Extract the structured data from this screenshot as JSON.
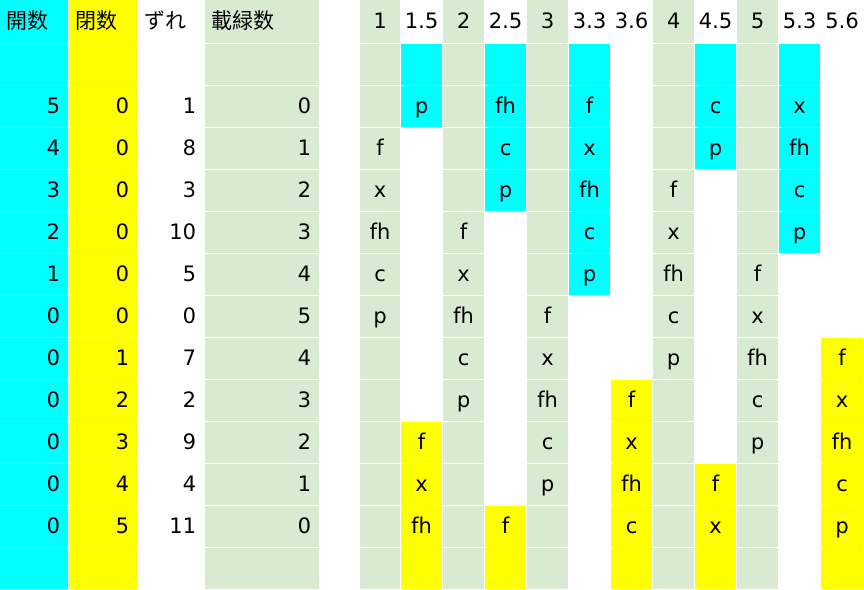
{
  "colors": {
    "cyan": "#00ffff",
    "yellow": "#ffff00",
    "green": "#d9ead3",
    "white": "#ffffff"
  },
  "column_fills": [
    "cyan",
    "yellow",
    "white",
    "green",
    "white",
    "green",
    "white",
    "green",
    "white",
    "green",
    "white",
    "white",
    "green",
    "white",
    "green",
    "white",
    "white"
  ],
  "headers": [
    "開数",
    "閉数",
    "ずれ",
    "載緑数",
    "",
    "1",
    "1.5",
    "2",
    "2.5",
    "3",
    "3.3",
    "3.6",
    "4",
    "4.5",
    "5",
    "5.3",
    "5.6"
  ],
  "rows": [
    {
      "values": [
        "",
        "",
        "",
        "",
        "",
        "",
        "",
        "",
        "",
        "",
        "",
        "",
        "",
        "",
        "",
        "",
        ""
      ],
      "fills": {
        "6": "cyan",
        "8": "cyan",
        "10": "cyan",
        "13": "cyan",
        "15": "cyan"
      }
    },
    {
      "values": [
        "5",
        "0",
        "1",
        "0",
        "",
        "",
        "p",
        "",
        "fh",
        "",
        "f",
        "",
        "",
        "c",
        "",
        "x",
        ""
      ],
      "fills": {
        "6": "cyan",
        "8": "cyan",
        "10": "cyan",
        "13": "cyan",
        "15": "cyan"
      }
    },
    {
      "values": [
        "4",
        "0",
        "8",
        "1",
        "",
        "f",
        "",
        "",
        "c",
        "",
        "x",
        "",
        "",
        "p",
        "",
        "fh",
        ""
      ],
      "fills": {
        "8": "cyan",
        "10": "cyan",
        "13": "cyan",
        "15": "cyan"
      }
    },
    {
      "values": [
        "3",
        "0",
        "3",
        "2",
        "",
        "x",
        "",
        "",
        "p",
        "",
        "fh",
        "",
        "f",
        "",
        "",
        "c",
        ""
      ],
      "fills": {
        "8": "cyan",
        "10": "cyan",
        "15": "cyan"
      }
    },
    {
      "values": [
        "2",
        "0",
        "10",
        "3",
        "",
        "fh",
        "",
        "f",
        "",
        "",
        "c",
        "",
        "x",
        "",
        "",
        "p",
        ""
      ],
      "fills": {
        "10": "cyan",
        "15": "cyan"
      }
    },
    {
      "values": [
        "1",
        "0",
        "5",
        "4",
        "",
        "c",
        "",
        "x",
        "",
        "",
        "p",
        "",
        "fh",
        "",
        "f",
        "",
        ""
      ],
      "fills": {
        "10": "cyan"
      }
    },
    {
      "values": [
        "0",
        "0",
        "0",
        "5",
        "",
        "p",
        "",
        "fh",
        "",
        "f",
        "",
        "",
        "c",
        "",
        "x",
        "",
        ""
      ],
      "fills": {}
    },
    {
      "values": [
        "0",
        "1",
        "7",
        "4",
        "",
        "",
        "",
        "c",
        "",
        "x",
        "",
        "",
        "p",
        "",
        "fh",
        "",
        "f"
      ],
      "fills": {
        "16": "yellow"
      }
    },
    {
      "values": [
        "0",
        "2",
        "2",
        "3",
        "",
        "",
        "",
        "p",
        "",
        "fh",
        "",
        "f",
        "",
        "",
        "c",
        "",
        "x"
      ],
      "fills": {
        "11": "yellow",
        "16": "yellow"
      }
    },
    {
      "values": [
        "0",
        "3",
        "9",
        "2",
        "",
        "",
        "f",
        "",
        "",
        "c",
        "",
        "x",
        "",
        "",
        "p",
        "",
        "fh"
      ],
      "fills": {
        "6": "yellow",
        "11": "yellow",
        "16": "yellow"
      }
    },
    {
      "values": [
        "0",
        "4",
        "4",
        "1",
        "",
        "",
        "x",
        "",
        "",
        "p",
        "",
        "fh",
        "",
        "f",
        "",
        "",
        "c"
      ],
      "fills": {
        "6": "yellow",
        "11": "yellow",
        "13": "yellow",
        "16": "yellow"
      }
    },
    {
      "values": [
        "0",
        "5",
        "11",
        "0",
        "",
        "",
        "fh",
        "",
        "f",
        "",
        "",
        "c",
        "",
        "x",
        "",
        "",
        "p"
      ],
      "fills": {
        "6": "yellow",
        "8": "yellow",
        "11": "yellow",
        "13": "yellow",
        "16": "yellow"
      }
    },
    {
      "values": [
        "",
        "",
        "",
        "",
        "",
        "",
        "",
        "",
        "",
        "",
        "",
        "",
        "",
        "",
        "",
        "",
        ""
      ],
      "fills": {
        "6": "yellow",
        "8": "yellow",
        "11": "yellow",
        "13": "yellow",
        "16": "yellow"
      }
    }
  ]
}
